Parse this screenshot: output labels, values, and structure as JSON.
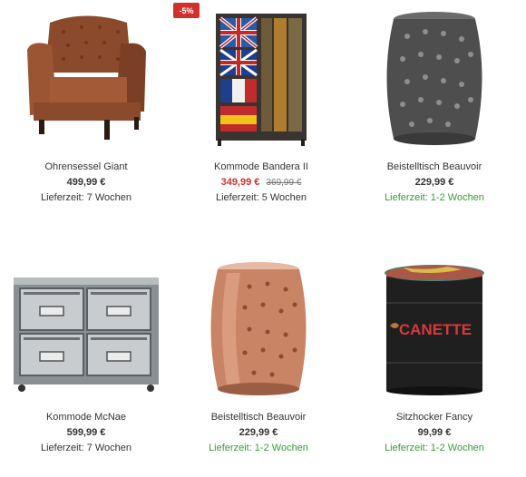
{
  "products": [
    {
      "name": "Ohrensessel Giant",
      "price": "499,99 €",
      "old_price": "",
      "delivery": "Lieferzeit: 7 Wochen",
      "delivery_fast": false,
      "image_icon": "armchair-image"
    },
    {
      "name": "Kommode Bandera II",
      "price": "349,99 €",
      "old_price": "369,99 €",
      "delivery": "Lieferzeit: 5 Wochen",
      "delivery_fast": false,
      "badge": "-5%",
      "image_icon": "flag-dresser-image"
    },
    {
      "name": "Beistelltisch Beauvoir",
      "price": "229,99 €",
      "old_price": "",
      "delivery": "Lieferzeit: 1-2 Wochen",
      "delivery_fast": true,
      "image_icon": "metal-side-table-image"
    },
    {
      "name": "Kommode McNae",
      "price": "599,99 €",
      "old_price": "",
      "delivery": "Lieferzeit: 7 Wochen",
      "delivery_fast": false,
      "image_icon": "drawer-cabinet-image"
    },
    {
      "name": "Beistelltisch Beauvoir",
      "price": "229,99 €",
      "old_price": "",
      "delivery": "Lieferzeit: 1-2 Wochen",
      "delivery_fast": true,
      "image_icon": "copper-side-table-image"
    },
    {
      "name": "Sitzhocker Fancy",
      "price": "99,99 €",
      "old_price": "",
      "delivery": "Lieferzeit: 1-2 Wochen",
      "delivery_fast": true,
      "image_icon": "barrel-stool-image",
      "image_text": "CANETTE"
    }
  ],
  "colors": {
    "sale": "#d0312d",
    "delivery_fast": "#3b9a3b",
    "text": "#333333"
  }
}
